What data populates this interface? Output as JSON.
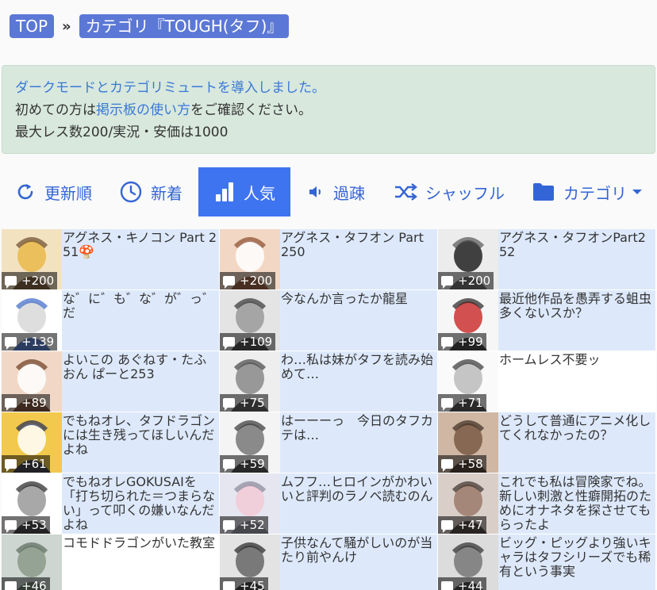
{
  "breadcrumb": {
    "top": "TOP",
    "sep": "»",
    "category": "カテゴリ『TOUGH(タフ)』"
  },
  "notice": {
    "line1": "ダークモードとカテゴリミュートを導入しました。",
    "line2_pre": "初めての方は",
    "line2_link": "掲示板の使い方",
    "line2_post": "をご確認ください。",
    "line3": "最大レス数200/実況・安価は1000"
  },
  "tabs": [
    {
      "label": "更新順",
      "icon": "refresh-icon"
    },
    {
      "label": "新着",
      "icon": "clock-icon"
    },
    {
      "label": "人気",
      "icon": "bar-chart-icon",
      "active": true
    },
    {
      "label": "過疎",
      "icon": "speaker-icon"
    },
    {
      "label": "シャッフル",
      "icon": "shuffle-icon"
    },
    {
      "label": "カテゴリ",
      "icon": "folder-icon",
      "dropdown": true
    }
  ],
  "threads": [
    {
      "title": "アグネス・キノコン Part 251🍄",
      "count": "+200"
    },
    {
      "title": "アグネス・タフオン Part 250",
      "count": "+200"
    },
    {
      "title": "アグネス・タフオンPart252",
      "count": "+200"
    },
    {
      "title": "な゛に゛も゛な゛が゛っ゛だ",
      "count": "+139"
    },
    {
      "title": "今なんか言ったか龍星",
      "count": "+109"
    },
    {
      "title": "最近他作品を愚弄する蛆虫多くないスか？",
      "count": "+99"
    },
    {
      "title": "よいこの あぐねす・たふおん ぱーと253",
      "count": "+89"
    },
    {
      "title": "わ…私は妹がタフを読み始めて…",
      "count": "+75"
    },
    {
      "title": "ホームレス不要ッ",
      "count": "+71"
    },
    {
      "title": "でもねオレ、タフドラゴンには生き残ってほしいんだよね",
      "count": "+61"
    },
    {
      "title": "はーーーっ　今日のタフカテは…",
      "count": "+59"
    },
    {
      "title": "どうして普通にアニメ化してくれなかったの？",
      "count": "+58"
    },
    {
      "title": "でもねオレGOKUSAIを「打ち切られた＝つまらない」って叩くの嫌いなんだよね",
      "count": "+53"
    },
    {
      "title": "ムフフ…ヒロインがかわいいと評判のラノベ読むのん",
      "count": "+52"
    },
    {
      "title": "これでも私は冒険家でね。新しい刺激と性癖開拓のためにオナネタを探させてもらったよ",
      "count": "+47"
    },
    {
      "title": "コモドドラゴンがいた教室",
      "count": "+46"
    },
    {
      "title": "子供なんて騒がしいのが当たり前やんけ",
      "count": "+45"
    },
    {
      "title": "ビッグ・ピッグより強いキャラはタフシリーズでも稀有という事実",
      "count": "+44"
    }
  ],
  "colors": {
    "accent": "#3f74f0",
    "link": "#3465d6",
    "crumb": "#5b78d6",
    "notice_bg": "#d8e8dd",
    "cell_bg": "#dde9fb"
  }
}
